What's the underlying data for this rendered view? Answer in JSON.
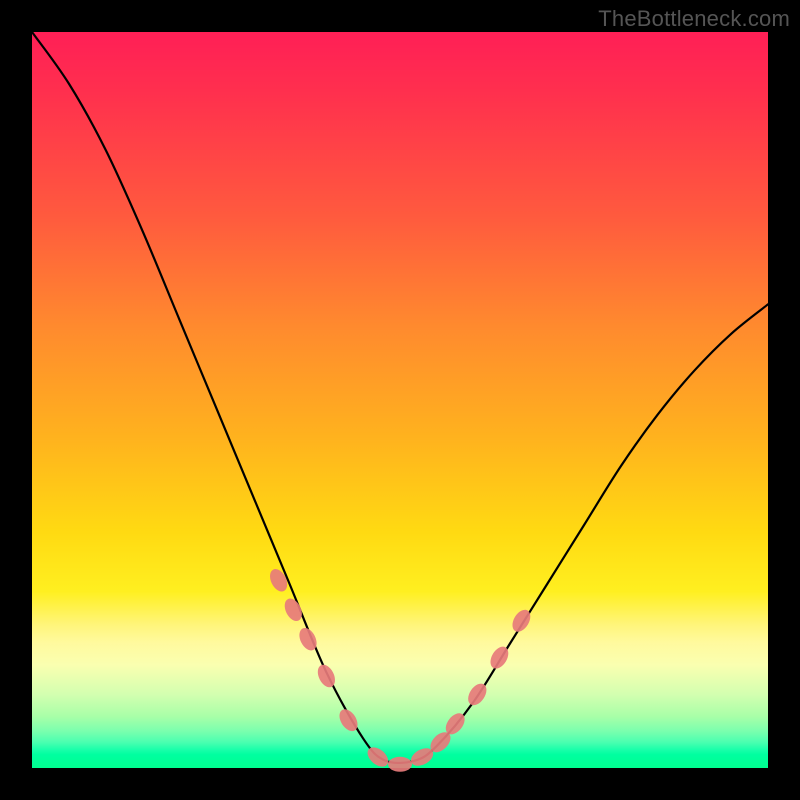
{
  "watermark": "TheBottleneck.com",
  "chart_data": {
    "type": "line",
    "title": "",
    "xlabel": "",
    "ylabel": "",
    "xlim": [
      0,
      1
    ],
    "ylim": [
      0,
      1
    ],
    "series": [
      {
        "name": "bottleneck-curve",
        "x": [
          0.0,
          0.05,
          0.1,
          0.15,
          0.2,
          0.25,
          0.3,
          0.35,
          0.4,
          0.45,
          0.48,
          0.52,
          0.55,
          0.6,
          0.65,
          0.7,
          0.75,
          0.8,
          0.85,
          0.9,
          0.95,
          1.0
        ],
        "y": [
          1.0,
          0.93,
          0.84,
          0.73,
          0.61,
          0.49,
          0.37,
          0.25,
          0.13,
          0.04,
          0.01,
          0.01,
          0.03,
          0.09,
          0.17,
          0.25,
          0.33,
          0.41,
          0.48,
          0.54,
          0.59,
          0.63
        ]
      }
    ],
    "markers": {
      "name": "highlight-dots",
      "style": "pink-capsule",
      "x": [
        0.335,
        0.355,
        0.375,
        0.4,
        0.43,
        0.47,
        0.5,
        0.53,
        0.555,
        0.575,
        0.605,
        0.635,
        0.665
      ],
      "y": [
        0.255,
        0.215,
        0.175,
        0.125,
        0.065,
        0.015,
        0.005,
        0.015,
        0.035,
        0.06,
        0.1,
        0.15,
        0.2
      ]
    },
    "gradient_stops": [
      {
        "pos": 0.0,
        "color": "#ff1f56"
      },
      {
        "pos": 0.25,
        "color": "#ff5a3e"
      },
      {
        "pos": 0.55,
        "color": "#ffb21e"
      },
      {
        "pos": 0.76,
        "color": "#ffef20"
      },
      {
        "pos": 0.9,
        "color": "#d3ffb0"
      },
      {
        "pos": 1.0,
        "color": "#00ff90"
      }
    ]
  }
}
